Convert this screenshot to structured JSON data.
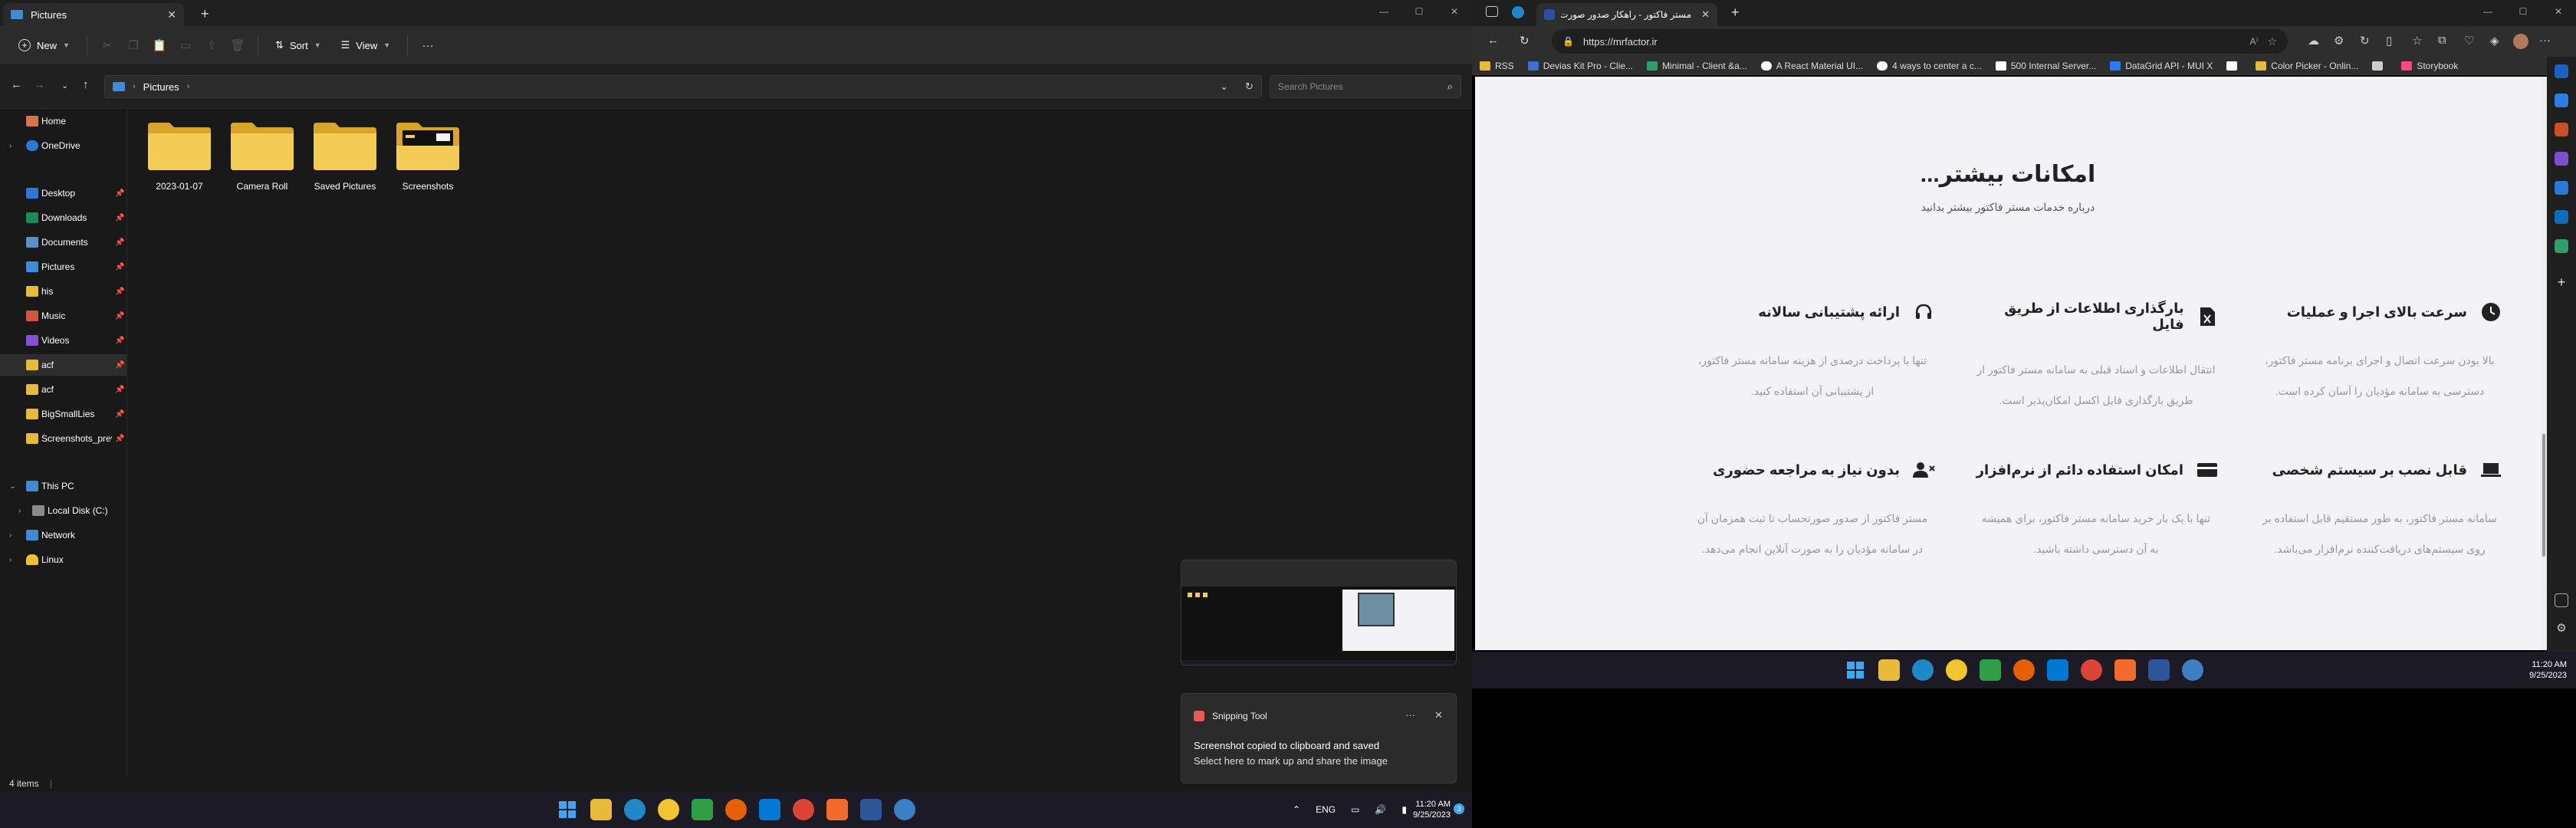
{
  "explorer": {
    "tab_title": "Pictures",
    "toolbar": {
      "new_label": "New",
      "sort_label": "Sort",
      "view_label": "View"
    },
    "breadcrumb": {
      "segments": [
        "Pictures"
      ]
    },
    "search_placeholder": "Search Pictures",
    "nav": {
      "home": "Home",
      "onedrive": "OneDrive",
      "quick_access": [
        {
          "label": "Desktop",
          "icon": "desktop-icon",
          "color": "#2b79d6"
        },
        {
          "label": "Downloads",
          "icon": "download-icon",
          "color": "#1e8a5a"
        },
        {
          "label": "Documents",
          "icon": "document-icon",
          "color": "#5b8fc9"
        },
        {
          "label": "Pictures",
          "icon": "picture-icon",
          "color": "#3c8dd6"
        },
        {
          "label": "his",
          "icon": "folder-icon",
          "color": "#e8b93a"
        },
        {
          "label": "Music",
          "icon": "music-icon",
          "color": "#d3563a"
        },
        {
          "label": "Videos",
          "icon": "video-icon",
          "color": "#8a4fd1"
        },
        {
          "label": "acf",
          "icon": "folder-icon",
          "color": "#e8b93a"
        },
        {
          "label": "acf",
          "icon": "folder-icon",
          "color": "#e8b93a"
        },
        {
          "label": "BigSmallLies",
          "icon": "folder-icon",
          "color": "#e8b93a"
        },
        {
          "label": "Screenshots_prev",
          "icon": "folder-icon",
          "color": "#e8b93a"
        }
      ],
      "this_pc": "This PC",
      "local_disk": "Local Disk (C:)",
      "network": "Network",
      "linux": "Linux"
    },
    "folders": [
      {
        "name": "2023-01-07"
      },
      {
        "name": "Camera Roll"
      },
      {
        "name": "Saved Pictures"
      },
      {
        "name": "Screenshots"
      }
    ],
    "status": "4 items"
  },
  "snipping_toast": {
    "app_name": "Snipping Tool",
    "title": "Screenshot copied to clipboard and saved",
    "body": "Select here to mark up and share the image"
  },
  "taskbar_left": {
    "lang": "ENG",
    "time": "11:20 AM",
    "date": "9/25/2023"
  },
  "browser": {
    "tab_title": "مستر فاکتور - راهکار صدور صورت...",
    "url": "https://mrfactor.ir",
    "bookmarks": [
      {
        "label": "RSS",
        "color": "#e8b93a"
      },
      {
        "label": "Devias Kit Pro - Clie...",
        "color": "#3a6fd8"
      },
      {
        "label": "Minimal - Client &a...",
        "color": "#2f9e6a"
      },
      {
        "label": "A React Material UI...",
        "color": "#ffffff"
      },
      {
        "label": "4 ways to center a c...",
        "color": "#ffffff"
      },
      {
        "label": "500 Internal Server...",
        "color": "#ffffff"
      },
      {
        "label": "DataGrid API - MUI X",
        "color": "#2979ff"
      },
      {
        "label": "",
        "color": "#ffffff"
      },
      {
        "label": "Color Picker - Onlin...",
        "color": "#e8b93a"
      },
      {
        "label": "",
        "color": "#cccccc"
      },
      {
        "label": "Storybook",
        "color": "#ff4785"
      }
    ]
  },
  "webpage": {
    "title": "امکانات بیشتر...",
    "subtitle": "درباره خدمات مستر فاکتور بیشتر بدانید",
    "features": [
      {
        "title": "سرعت بالای اجرا و عملیات",
        "icon": "clock-icon",
        "desc1": "بالا بودن سرعت اتصال و اجرای برنامه مستر فاکتور،",
        "desc2": "دسترسی به سامانه مؤدیان را آسان کرده است."
      },
      {
        "title": "بارگذاری اطلاعات از طریق فایل",
        "icon": "excel-file-icon",
        "desc1": "انتقال اطلاعات و اسناد قبلی به سامانه مستر فاکتور از",
        "desc2": "طریق بارگذاری فایل اکسل امکان‌پذیر است."
      },
      {
        "title": "ارائه پشتیبانی سالانه",
        "icon": "headset-icon",
        "desc1": "تنها با پرداخت درصدی از هزینه سامانه مستر فاکتور،",
        "desc2": "از پشتیبانی آن استفاده کنید."
      },
      {
        "title": "قابل نصب بر سیستم شخصی",
        "icon": "laptop-icon",
        "desc1": "سامانه مستر فاکتور، به طور مستقیم قابل استفاده بر",
        "desc2": "روی سیستم‌های دریافت‌کننده نرم‌افزار می‌باشد."
      },
      {
        "title": "امکان استفاده دائم از نرم‌افزار",
        "icon": "credit-card-icon",
        "desc1": "تنها با یک بار خرید سامانه مستر فاکتور، برای همیشه",
        "desc2": "به آن دسترسی داشته باشید."
      },
      {
        "title": "بدون نیاز به مراجعه حضوری",
        "icon": "user-remove-icon",
        "desc1": "مستر فاکتور از صدور صورتحساب تا ثبت همزمان آن",
        "desc2": "در سامانه مؤدیان را به صورت آنلاین انجام می‌دهد."
      }
    ]
  },
  "taskbar_right": {
    "time": "11:20 AM",
    "date": "9/25/2023"
  }
}
